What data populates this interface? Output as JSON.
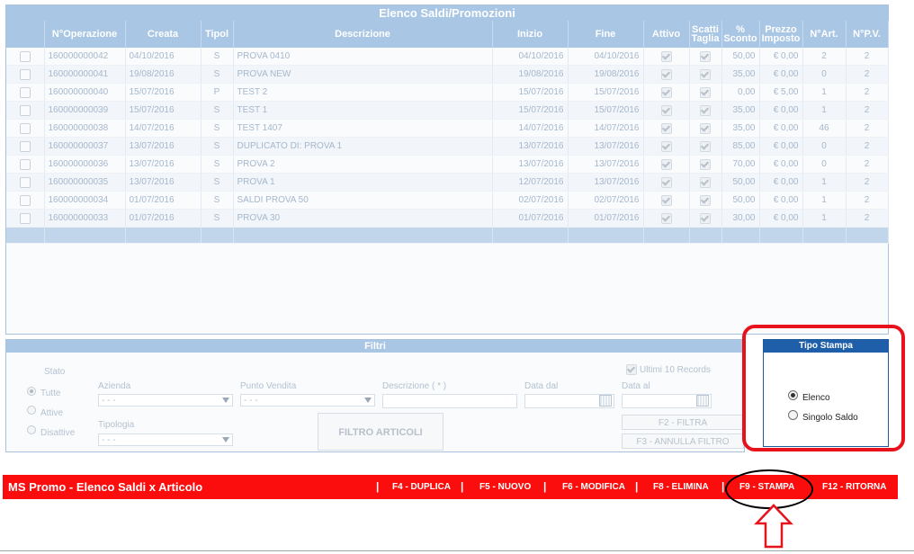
{
  "grid": {
    "title": "Elenco Saldi/Promozioni",
    "headers": [
      "",
      "N°Operazione",
      "Creata",
      "Tipol",
      "Descrizione",
      "Inizio",
      "Fine",
      "Attivo",
      "Scatti Taglia",
      "% Sconto",
      "Prezzo Imposto",
      "N°Art.",
      "N°P.V."
    ],
    "rows": [
      {
        "op": "160000000042",
        "creata": "04/10/2016",
        "tipol": "S",
        "descr": "PROVA 0410",
        "inizio": "04/10/2016",
        "fine": "04/10/2016",
        "sconto": "50,00",
        "prezzo": "€ 0,00",
        "nart": "2",
        "npv": "2"
      },
      {
        "op": "160000000041",
        "creata": "19/08/2016",
        "tipol": "S",
        "descr": "PROVA NEW",
        "inizio": "19/08/2016",
        "fine": "19/08/2016",
        "sconto": "35,00",
        "prezzo": "€ 0,00",
        "nart": "0",
        "npv": "2"
      },
      {
        "op": "160000000040",
        "creata": "15/07/2016",
        "tipol": "P",
        "descr": "TEST 2",
        "inizio": "15/07/2016",
        "fine": "15/07/2016",
        "sconto": "0,00",
        "prezzo": "€ 5,00",
        "nart": "1",
        "npv": "2"
      },
      {
        "op": "160000000039",
        "creata": "15/07/2016",
        "tipol": "S",
        "descr": "TEST 1",
        "inizio": "15/07/2016",
        "fine": "15/07/2016",
        "sconto": "35,00",
        "prezzo": "€ 0,00",
        "nart": "1",
        "npv": "2"
      },
      {
        "op": "160000000038",
        "creata": "14/07/2016",
        "tipol": "S",
        "descr": "TEST 1407",
        "inizio": "14/07/2016",
        "fine": "14/07/2016",
        "sconto": "35,00",
        "prezzo": "€ 0,00",
        "nart": "46",
        "npv": "2"
      },
      {
        "op": "160000000037",
        "creata": "13/07/2016",
        "tipol": "S",
        "descr": "DUPLICATO DI: PROVA 1",
        "inizio": "13/07/2016",
        "fine": "13/07/2016",
        "sconto": "85,00",
        "prezzo": "€ 0,00",
        "nart": "0",
        "npv": "2"
      },
      {
        "op": "160000000036",
        "creata": "13/07/2016",
        "tipol": "S",
        "descr": "PROVA 2",
        "inizio": "13/07/2016",
        "fine": "13/07/2016",
        "sconto": "70,00",
        "prezzo": "€ 0,00",
        "nart": "0",
        "npv": "2"
      },
      {
        "op": "160000000035",
        "creata": "13/07/2016",
        "tipol": "S",
        "descr": "PROVA 1",
        "inizio": "12/07/2016",
        "fine": "13/07/2016",
        "sconto": "50,00",
        "prezzo": "€ 0,00",
        "nart": "1",
        "npv": "2"
      },
      {
        "op": "160000000034",
        "creata": "01/07/2016",
        "tipol": "S",
        "descr": "SALDI PROVA 50",
        "inizio": "02/07/2016",
        "fine": "02/07/2016",
        "sconto": "50,00",
        "prezzo": "€ 0,00",
        "nart": "1",
        "npv": "2"
      },
      {
        "op": "160000000033",
        "creata": "01/07/2016",
        "tipol": "S",
        "descr": "PROVA 30",
        "inizio": "01/07/2016",
        "fine": "01/07/2016",
        "sconto": "30,00",
        "prezzo": "€ 0,00",
        "nart": "1",
        "npv": "2"
      }
    ]
  },
  "filters": {
    "title": "Filtri",
    "stato_label": "Stato",
    "stato_options": [
      "Tutte",
      "Attive",
      "Disattive"
    ],
    "azienda_label": "Azienda",
    "azienda_value": "- - -",
    "punto_vendita_label": "Punto Vendita",
    "punto_vendita_value": "- - -",
    "descrizione_label": "Descrizione ( * )",
    "data_dal_label": "Data dal",
    "data_al_label": "Data al",
    "tipologia_label": "Tipologia",
    "tipologia_value": "- - -",
    "ultimi_label": "Ultimi 10 Records",
    "filtro_articoli": "FILTRO ARTICOLI",
    "filtra": "F2 - FILTRA",
    "annulla_filtro": "F3 - ANNULLA FILTRO"
  },
  "tipo_stampa": {
    "title": "Tipo Stampa",
    "options": [
      "Elenco",
      "Singolo Saldo"
    ],
    "selected": "Elenco"
  },
  "toolbar": {
    "title": "MS Promo - Elenco Saldi x Articolo",
    "duplica": "F4 - DUPLICA",
    "nuovo": "F5 - NUOVO",
    "modifica": "F6 - MODIFICA",
    "elimina": "F8 - ELIMINA",
    "stampa": "F9 - STAMPA",
    "ritorna": "F12 - RITORNA",
    "separator": "|"
  },
  "colors": {
    "toolbar_bg": "#fb0d0d",
    "grid_header": "#a9c6e4",
    "tipo_header": "#1f5ea8",
    "highlight_red": "#e8121c",
    "arrow": "#e8121c"
  }
}
